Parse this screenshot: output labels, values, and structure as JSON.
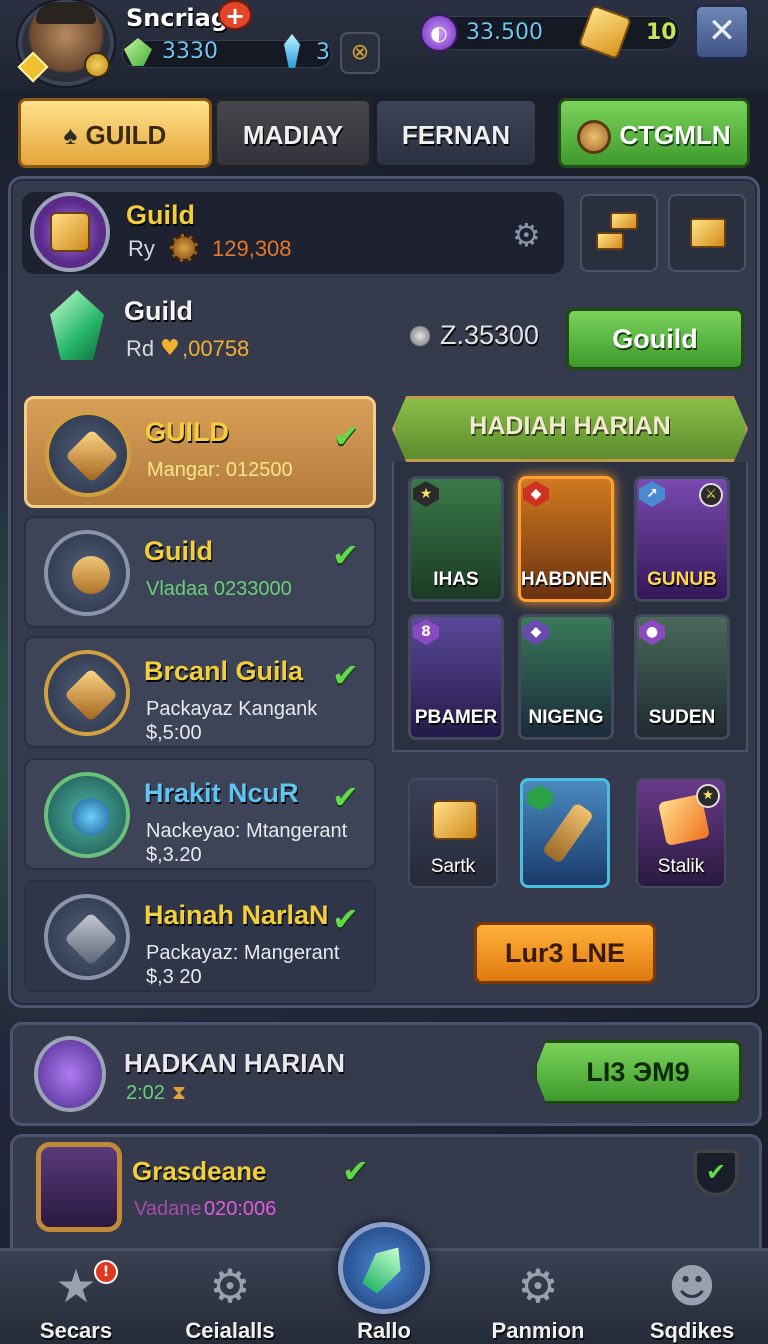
{
  "player": {
    "name": "Sncriag",
    "currency_green": "3330",
    "currency_blue": "3",
    "currency_purple": "33.500",
    "currency_gold": "10"
  },
  "tabs": [
    {
      "label": "GUILD"
    },
    {
      "label": "MADIAY"
    },
    {
      "label": "FERNAN"
    },
    {
      "label": "CTGMLN"
    }
  ],
  "guild_header": {
    "title": "Guild",
    "sub_label": "Ry",
    "value": "129,308"
  },
  "guild_row2": {
    "title": "Guild",
    "sub_label": "Rd",
    "value": ",00758",
    "amount": "Z.35300",
    "button": "Gouild"
  },
  "list_items": [
    {
      "title": "GUILD",
      "sub": "Mangar: 012500",
      "price": ""
    },
    {
      "title": "Guild",
      "sub": "Vladaa 0233000",
      "price": ""
    },
    {
      "title": "Brcanl Guila",
      "sub": "Packayaz Kangank",
      "price": "$,5:00"
    },
    {
      "title": "Hrakit NcuR",
      "sub": "Nackeyao: Mtangerant",
      "price": "$,3.20"
    },
    {
      "title": "Hainah NarlaN",
      "sub": "Packayaz: Mangerant",
      "price": "$,3 20"
    }
  ],
  "rewards": {
    "banner": "HADIAH HARIAN",
    "cards": [
      {
        "label": "IHAS",
        "badge": "",
        "color": "#3b7a4a"
      },
      {
        "label": "HABDNEN",
        "badge": "",
        "color": "#b6651c"
      },
      {
        "label": "GUNUB",
        "badge": "",
        "color": "#6a3a9a"
      },
      {
        "label": "PBAMER",
        "badge": "8",
        "color": "#4a3a7a"
      },
      {
        "label": "NIGENG",
        "badge": "",
        "color": "#3a5a6a"
      },
      {
        "label": "SUDEN",
        "badge": "",
        "color": "#3a4a5a"
      }
    ],
    "small_cards": [
      {
        "label": "Sartk"
      },
      {
        "label": ""
      },
      {
        "label": "Stalik"
      }
    ],
    "button": "Lur3 LNE"
  },
  "daily": {
    "title": "HADKAN HARIAN",
    "time": "2:02",
    "button": "LI3 ЭМ9"
  },
  "grade": {
    "title": "Grasdeane",
    "sub": "Vadane",
    "value": "020:006"
  },
  "nav": [
    {
      "label": "Secars",
      "badge": "!"
    },
    {
      "label": "Ceialalls",
      "badge": ""
    },
    {
      "label": "Rallo",
      "badge": ""
    },
    {
      "label": "Panmion",
      "badge": ""
    },
    {
      "label": "Sqdikes",
      "badge": ""
    }
  ],
  "colors": {
    "accent_gold": "#f3d03a",
    "accent_green": "#62d84a",
    "accent_orange": "#e07a10",
    "panel": "#353b4d"
  },
  "icons": {
    "close": "close-icon",
    "settings": "gear-icon",
    "check": "check-icon"
  }
}
